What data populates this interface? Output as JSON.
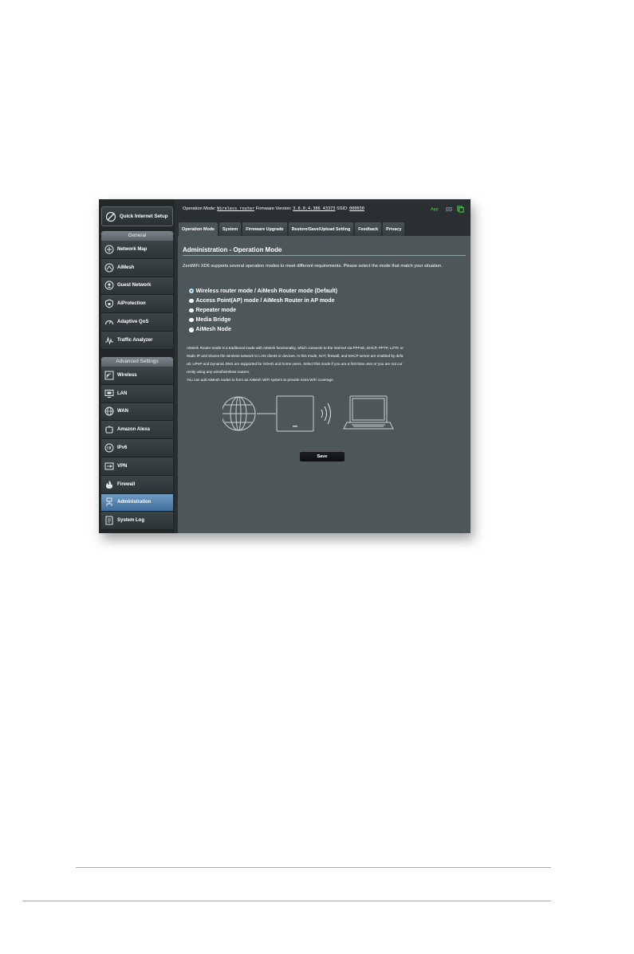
{
  "header": {
    "operation_mode_label": "Operation Mode:",
    "operation_mode_value": "Wireless router",
    "firmware_label": "Firmware Version:",
    "firmware_value": "3.0.0.4.386_43373",
    "ssid_label": "SSID:",
    "ssid_value": "000030",
    "app_label": "App"
  },
  "sidebar": {
    "quick_setup": "Quick Internet Setup",
    "general_heading": "General",
    "general_items": [
      {
        "label": "Network Map",
        "icon": "network-map-icon"
      },
      {
        "label": "AiMesh",
        "icon": "aimesh-icon"
      },
      {
        "label": "Guest Network",
        "icon": "guest-network-icon"
      },
      {
        "label": "AiProtection",
        "icon": "shield-icon"
      },
      {
        "label": "Adaptive QoS",
        "icon": "speedometer-icon"
      },
      {
        "label": "Traffic Analyzer",
        "icon": "traffic-analyzer-icon"
      }
    ],
    "advanced_heading": "Advanced Settings",
    "advanced_items": [
      {
        "label": "Wireless",
        "icon": "wifi-icon"
      },
      {
        "label": "LAN",
        "icon": "lan-icon"
      },
      {
        "label": "WAN",
        "icon": "globe-icon"
      },
      {
        "label": "Amazon Alexa",
        "icon": "alexa-icon"
      },
      {
        "label": "IPv6",
        "icon": "ipv6-icon"
      },
      {
        "label": "VPN",
        "icon": "vpn-icon"
      },
      {
        "label": "Firewall",
        "icon": "firewall-icon"
      },
      {
        "label": "Administration",
        "icon": "administration-icon"
      },
      {
        "label": "System Log",
        "icon": "system-log-icon"
      }
    ]
  },
  "tabs": [
    "Operation Mode",
    "System",
    "Firmware Upgrade",
    "Restore/Save/Upload Setting",
    "Feedback",
    "Privacy"
  ],
  "main": {
    "title": "Administration - Operation Mode",
    "intro": "ZenWiFi XD6 supports several operation modes to meet different requirements. Please select the mode that match your situation.",
    "modes": [
      {
        "label": "Wireless router mode / AiMesh Router mode (Default)",
        "selected": true
      },
      {
        "label": "Access Point(AP) mode / AiMesh Router in AP mode",
        "selected": false
      },
      {
        "label": "Repeater mode",
        "selected": false
      },
      {
        "label": "Media Bridge",
        "selected": false
      },
      {
        "label": "AiMesh Node",
        "selected": false
      }
    ],
    "description_lines": [
      "AiMesh Router mode is a traditional mode with AiMesh functionality, which connects to the Internet via PPPoE, DHCP, PPTP, L2TP, or",
      "Static IP and shares the wireless network to LAN clients or devices. In this mode, NAT, firewall, and DHCP server are enabled by defa",
      "ult. UPnP and Dynamic DNS are supported for SOHO and home users. Select this mode if you are a first-time user or you are not cur",
      "rently using any wired/wireless routers.",
      "You can add AiMesh nodes to form an AiMesh WiFi system to provide extra WiFi coverage."
    ],
    "save_label": "Save"
  },
  "colors": {
    "panel": "#4d575a",
    "sidebar": "#232829",
    "active_nav": "#4f7fad",
    "app_green": "#3fd13f"
  }
}
